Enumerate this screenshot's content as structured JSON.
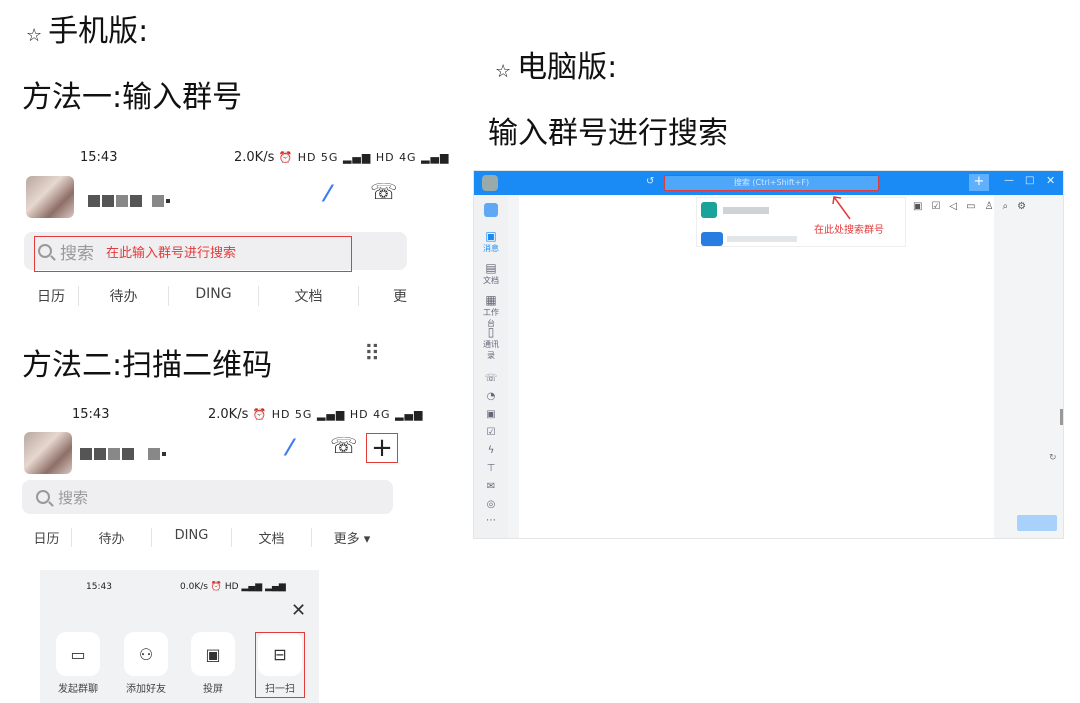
{
  "mobile_title": "手机版:",
  "desktop_title": "电脑版:",
  "star": "☆",
  "method1_title": "方法一:输入群号",
  "method2_title": "方法二:扫描二维码",
  "desktop_subtitle": "输入群号进行搜索",
  "phone1": {
    "time": "15:43",
    "speed": "2.0K/s",
    "status_icons": "⏰ HD 5G ▂▄▆ HD 4G ▂▄▆",
    "search_placeholder": "搜索",
    "annotation": "在此输入群号进行搜索",
    "tabs": [
      "日历",
      "待办",
      "DING",
      "文档",
      "更"
    ]
  },
  "phone2": {
    "time": "15:43",
    "speed": "2.0K/s",
    "status_icons": "⏰ HD 5G ▂▄▆ HD 4G ▂▄▆",
    "search_placeholder": "搜索",
    "tabs": [
      "日历",
      "待办",
      "DING",
      "文档",
      "更多 ▾"
    ]
  },
  "panel": {
    "time": "15:43",
    "speed": "0.0K/s",
    "status_icons": "⏰ HD ▂▄▆ ▂▄▆",
    "actions": [
      {
        "label": "发起群聊",
        "icon": "chat-icon"
      },
      {
        "label": "添加好友",
        "icon": "add-friend-icon"
      },
      {
        "label": "投屏",
        "icon": "screen-cast-icon"
      },
      {
        "label": "扫一扫",
        "icon": "scan-icon"
      }
    ]
  },
  "desktop": {
    "search_placeholder": "搜索 (Ctrl+Shift+F)",
    "annotation": "在此处搜索群号",
    "sidebar": [
      "消息",
      "文档",
      "工作台",
      "通讯录"
    ]
  },
  "colors": {
    "accent_red": "#e23b3b",
    "brand_blue": "#1a8bf4"
  }
}
